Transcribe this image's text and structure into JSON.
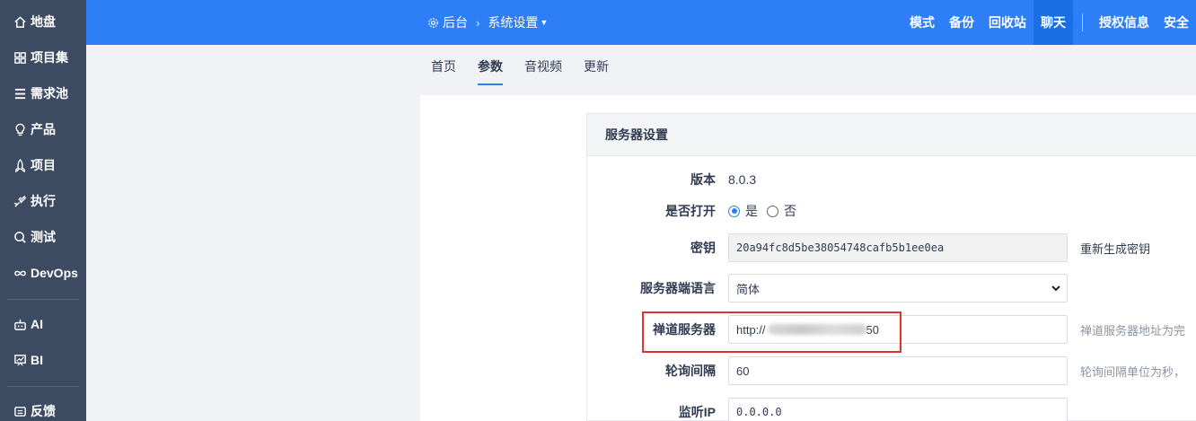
{
  "sidebar": {
    "items": [
      {
        "label": "地盘",
        "icon": "home-icon"
      },
      {
        "label": "项目集",
        "icon": "grid-icon"
      },
      {
        "label": "需求池",
        "icon": "list-icon"
      },
      {
        "label": "产品",
        "icon": "bulb-icon"
      },
      {
        "label": "项目",
        "icon": "rocket-icon"
      },
      {
        "label": "执行",
        "icon": "run-icon"
      },
      {
        "label": "测试",
        "icon": "magnifier-icon"
      },
      {
        "label": "DevOps",
        "icon": "infinity-icon"
      },
      {
        "label": "AI",
        "icon": "robot-icon"
      },
      {
        "label": "BI",
        "icon": "chart-board-icon"
      },
      {
        "label": "反馈",
        "icon": "feedback-icon"
      }
    ]
  },
  "topbar": {
    "breadcrumb": {
      "root": "后台",
      "current": "系统设置"
    },
    "links": [
      "模式",
      "备份",
      "回收站",
      "聊天",
      "授权信息",
      "安全"
    ],
    "active_link": "聊天",
    "accent": "#2e7ff7"
  },
  "tabs": {
    "items": [
      "首页",
      "参数",
      "音视频",
      "更新"
    ],
    "active": "参数"
  },
  "card": {
    "title": "服务器设置",
    "version": {
      "label": "版本",
      "value": "8.0.3"
    },
    "enable": {
      "label": "是否打开",
      "yes": "是",
      "no": "否",
      "selected": "是"
    },
    "key": {
      "label": "密钥",
      "value": "20a94fc8d5be38054748cafb5b1ee0ea",
      "action": "重新生成密钥"
    },
    "language": {
      "label": "服务器端语言",
      "value": "简体"
    },
    "server": {
      "label": "禅道服务器",
      "value_prefix": "http://",
      "value_suffix": "50",
      "hint": "禅道服务器地址为完"
    },
    "polling": {
      "label": "轮询间隔",
      "value": "60",
      "hint": "轮询间隔单位为秒，"
    },
    "listen_ip": {
      "label": "监听IP",
      "value": "0.0.0.0"
    }
  }
}
